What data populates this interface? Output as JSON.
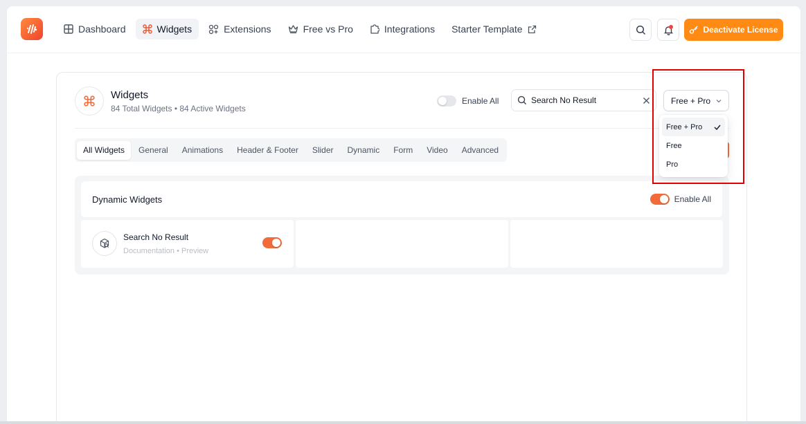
{
  "nav": {
    "items": [
      {
        "label": "Dashboard",
        "icon": "grid-icon"
      },
      {
        "label": "Widgets",
        "icon": "command-icon",
        "active": true
      },
      {
        "label": "Extensions",
        "icon": "extensions-icon"
      },
      {
        "label": "Free vs Pro",
        "icon": "crown-icon"
      },
      {
        "label": "Integrations",
        "icon": "puzzle-icon"
      },
      {
        "label": "Starter Template",
        "icon": "external-link-icon"
      }
    ],
    "deactivate_label": "Deactivate License"
  },
  "header": {
    "title": "Widgets",
    "subtitle": "84 Total Widgets • 84 Active Widgets",
    "enable_all_label": "Enable All",
    "search_value": "Search No Result",
    "filter_value": "Free + Pro"
  },
  "tabs": [
    "All Widgets",
    "General",
    "Animations",
    "Header & Footer",
    "Slider",
    "Dynamic",
    "Form",
    "Video",
    "Advanced"
  ],
  "section": {
    "title": "Dynamic Widgets",
    "enable_all_label": "Enable All",
    "widgets": [
      {
        "title": "Search No Result",
        "doc_label": "Documentation",
        "separator": "•",
        "preview_label": "Preview",
        "enabled": true
      }
    ]
  },
  "dropdown": {
    "options": [
      "Free + Pro",
      "Free",
      "Pro"
    ],
    "selected": "Free + Pro"
  },
  "colors": {
    "accent": "#f26b3a",
    "button_orange": "#ff8b14",
    "highlight": "#e00000"
  }
}
